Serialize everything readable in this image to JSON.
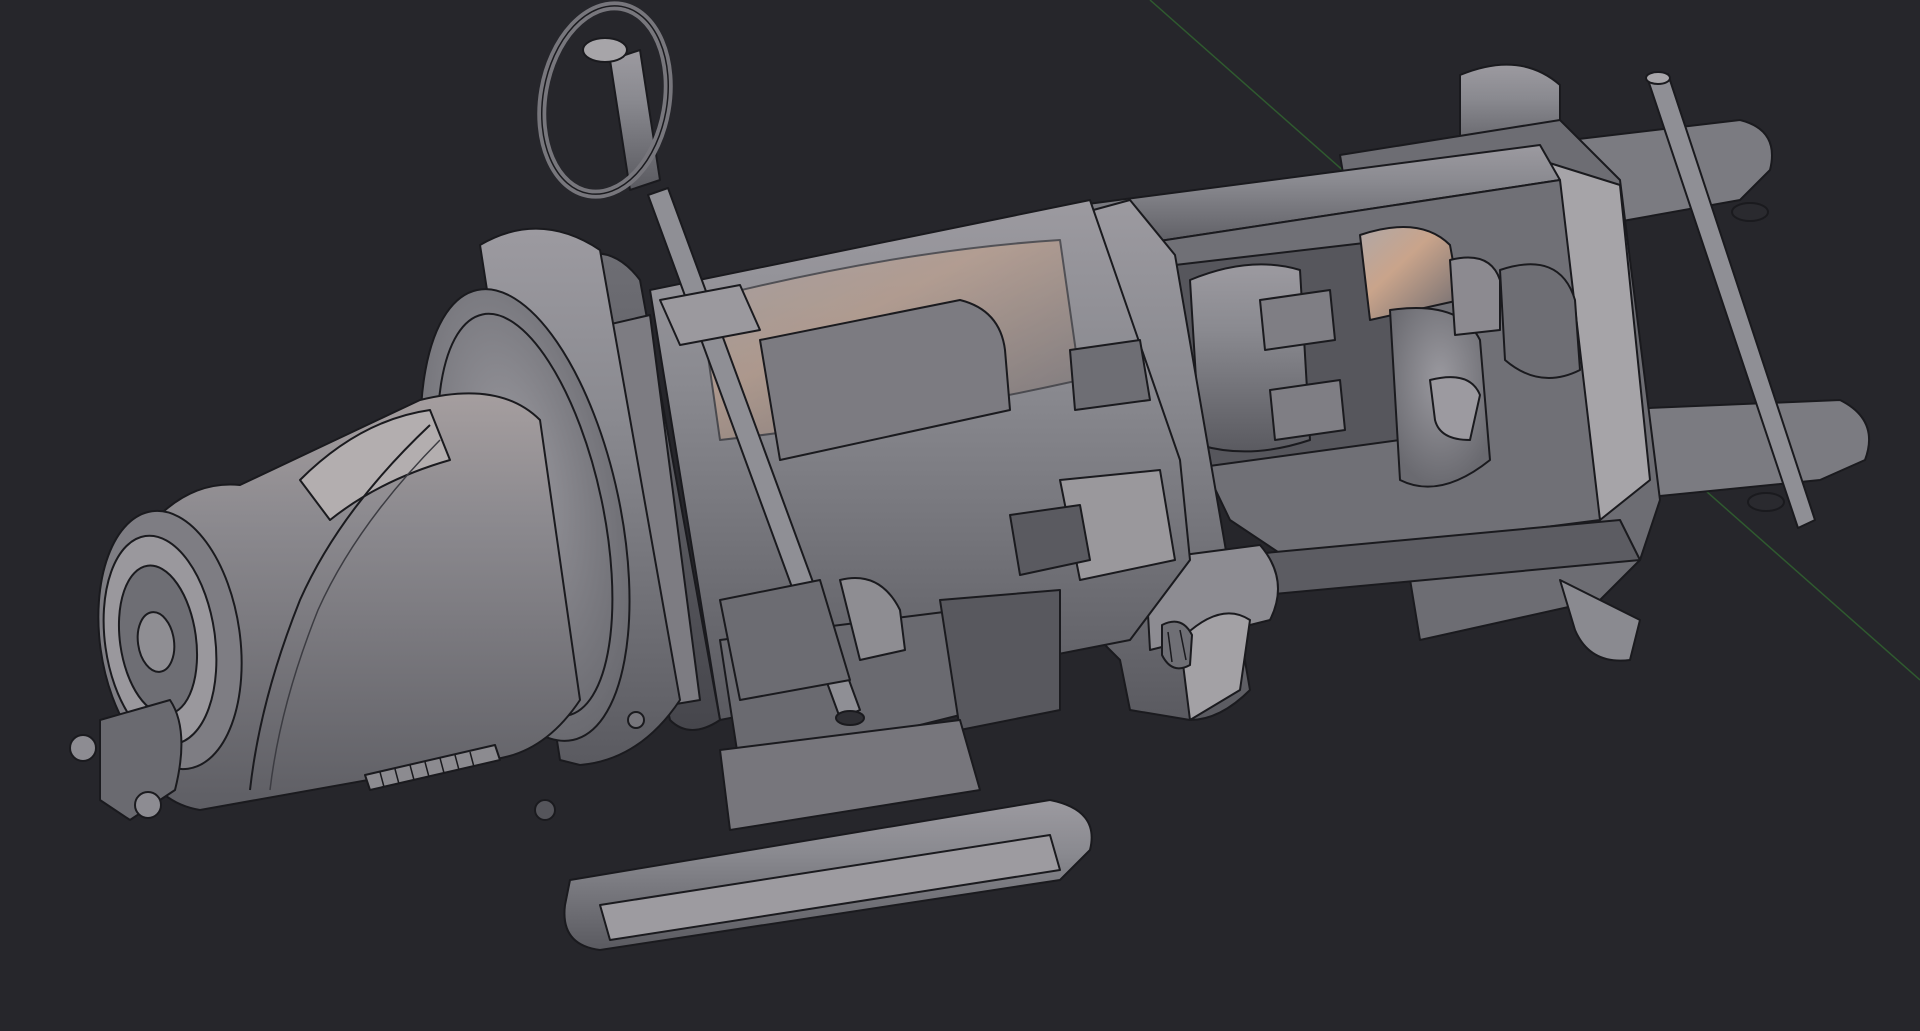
{
  "viewport": {
    "background": "#26262b",
    "axis_x_color": "#6a2b2b",
    "axis_y_color": "#2f5a2f",
    "shading": "solid"
  },
  "model": {
    "base_color": "#8a8a90",
    "light_color": "#b3b0b3",
    "dark_color": "#55555b",
    "edge_color": "#1a1a1e",
    "highlight_color": "#c9a48b",
    "icon": "cad-assembly-icon"
  }
}
